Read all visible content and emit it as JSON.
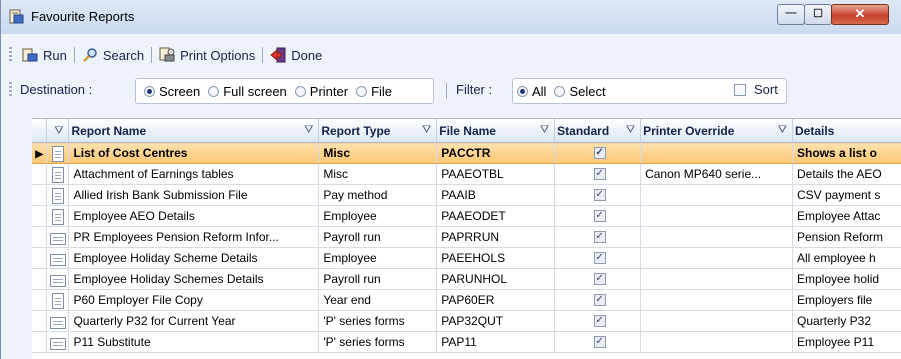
{
  "window": {
    "title": "Favourite Reports",
    "minimize": "—",
    "maximize": "☐",
    "close": "✕"
  },
  "toolbar": {
    "run_label": "Run",
    "search_label": "Search",
    "print_options_label": "Print Options",
    "done_label": "Done"
  },
  "destination": {
    "label": "Destination :",
    "options": [
      "Screen",
      "Full screen",
      "Printer",
      "File"
    ],
    "selected": "Screen"
  },
  "filter": {
    "label": "Filter :",
    "options": [
      "All",
      "Select"
    ],
    "selected": "All"
  },
  "sort": {
    "label": "Sort",
    "checked": false
  },
  "grid": {
    "columns": [
      "Report Name",
      "Report Type",
      "File Name",
      "Standard",
      "Printer Override",
      "Details"
    ],
    "rows": [
      {
        "name": "List of Cost Centres",
        "type": "Misc",
        "file": "PACCTR",
        "standard": true,
        "printer": "",
        "details": "Shows a list o",
        "icon": "report-icon",
        "selected": true
      },
      {
        "name": "Attachment of Earnings tables",
        "type": "Misc",
        "file": "PAAEOTBL",
        "standard": true,
        "printer": "Canon MP640 serie...",
        "details": "Details the AEO",
        "icon": "report-icon",
        "selected": false
      },
      {
        "name": "Allied Irish Bank Submission File",
        "type": "Pay method",
        "file": "PAAIB",
        "standard": true,
        "printer": "",
        "details": "CSV payment s",
        "icon": "report-icon",
        "selected": false
      },
      {
        "name": "Employee AEO Details",
        "type": "Employee",
        "file": "PAAEODET",
        "standard": true,
        "printer": "",
        "details": "Employee Attac",
        "icon": "report-icon",
        "selected": false
      },
      {
        "name": "PR Employees Pension Reform Infor...",
        "type": "Payroll run",
        "file": "PAPRRUN",
        "standard": true,
        "printer": "",
        "details": "Pension Reform",
        "icon": "landscape-report-icon",
        "selected": false
      },
      {
        "name": "Employee Holiday Scheme Details",
        "type": "Employee",
        "file": "PAEEHOLS",
        "standard": true,
        "printer": "",
        "details": "All employee h",
        "icon": "landscape-report-icon",
        "selected": false
      },
      {
        "name": "Employee Holiday Schemes Details",
        "type": "Payroll run",
        "file": "PARUNHOL",
        "standard": true,
        "printer": "",
        "details": "Employee holid",
        "icon": "landscape-report-icon",
        "selected": false
      },
      {
        "name": "P60 Employer File Copy",
        "type": "Year end",
        "file": "PAP60ER",
        "standard": true,
        "printer": "",
        "details": "Employers file",
        "icon": "report-icon",
        "selected": false
      },
      {
        "name": "Quarterly P32 for Current Year",
        "type": "'P' series forms",
        "file": "PAP32QUT",
        "standard": true,
        "printer": "",
        "details": "Quarterly P32",
        "icon": "landscape-report-icon",
        "selected": false
      },
      {
        "name": "P11 Substitute",
        "type": "'P' series forms",
        "file": "PAP11",
        "standard": true,
        "printer": "",
        "details": "Employee P11",
        "icon": "landscape-report-icon",
        "selected": false
      }
    ]
  }
}
